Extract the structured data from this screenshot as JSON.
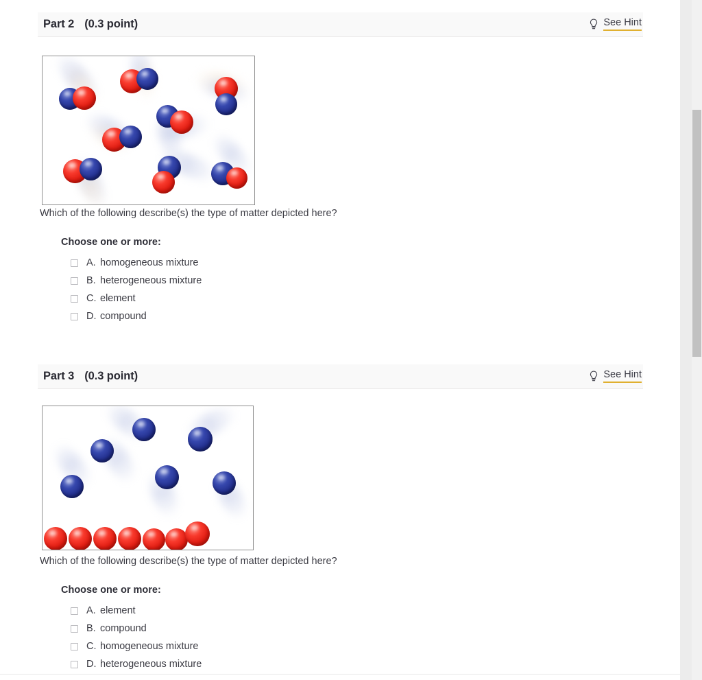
{
  "parts": [
    {
      "id": "part-2",
      "title_label": "Part 2",
      "points_label": "(0.3 point)",
      "hint": {
        "label": "See Hint",
        "icon": "lightbulb-icon",
        "underline_color": "#e0b030"
      },
      "question": "Which of the following describe(s) the type of matter depicted here?",
      "choose_label": "Choose one or more:",
      "options": [
        {
          "letter": "A.",
          "text": "homogeneous mixture",
          "checked": false
        },
        {
          "letter": "B.",
          "text": "heterogeneous mixture",
          "checked": false
        },
        {
          "letter": "C.",
          "text": "element",
          "checked": false
        },
        {
          "letter": "D.",
          "text": "compound",
          "checked": false
        }
      ],
      "figure": {
        "description": "Eight identical diatomic molecules, each made of one red atom bonded to one blue atom, dispersed with motion streaks on a white field",
        "red_color": "#e01d12",
        "blue_color": "#23308e",
        "molecule_count": 8,
        "atoms_per_molecule": 2
      }
    },
    {
      "id": "part-3",
      "title_label": "Part 3",
      "points_label": "(0.3 point)",
      "hint": {
        "label": "See Hint",
        "icon": "lightbulb-icon",
        "underline_color": "#e0b030"
      },
      "question": "Which of the following describe(s) the type of matter depicted here?",
      "choose_label": "Choose one or more:",
      "options": [
        {
          "letter": "A.",
          "text": "element",
          "checked": false
        },
        {
          "letter": "B.",
          "text": "compound",
          "checked": false
        },
        {
          "letter": "C.",
          "text": "homogeneous mixture",
          "checked": false
        },
        {
          "letter": "D.",
          "text": "heterogeneous mixture",
          "checked": false
        }
      ],
      "figure": {
        "description": "Six separate blue atoms floating with motion streaks above a packed row of seven red atoms resting along the bottom edge",
        "red_color": "#e01d12",
        "blue_color": "#23308e",
        "blue_atom_count": 6,
        "red_atom_count": 7
      }
    }
  ],
  "scrollbar": {
    "name": "vertical-scrollbar",
    "thumb_color": "#c1c1c1",
    "track_color": "#f1f1f1"
  }
}
